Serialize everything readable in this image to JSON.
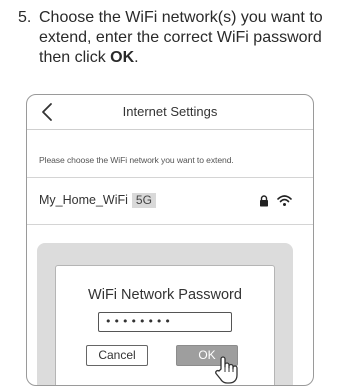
{
  "instruction": {
    "step_number": "5.",
    "text_before": "Choose the WiFi network(s) you want to extend, enter the correct WiFi password then click ",
    "text_bold": "OK",
    "text_after": "."
  },
  "screen": {
    "title": "Internet Settings",
    "hint": "Please choose the WiFi network you want to extend.",
    "network": {
      "name": "My_Home_WiFi",
      "band": "5G"
    }
  },
  "dialog": {
    "title": "WiFi Network Password",
    "password_value": "••••••••",
    "cancel_label": "Cancel",
    "ok_label": "OK"
  },
  "icons": {
    "back": "chevron-left-icon",
    "lock": "lock-icon",
    "wifi": "wifi-icon",
    "pointer": "hand-pointer-icon"
  },
  "colors": {
    "ok_button": "#9e9e9e",
    "backdrop": "#dcdcdc",
    "badge": "#d9d9d9"
  }
}
